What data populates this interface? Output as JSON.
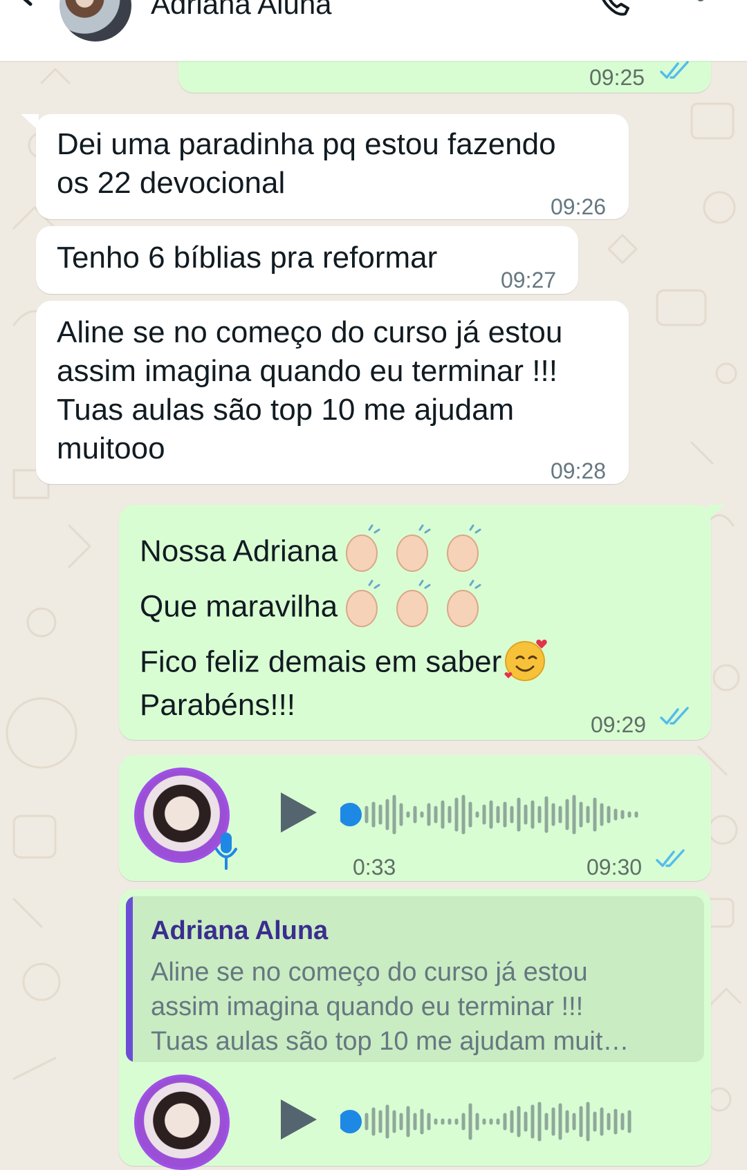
{
  "header": {
    "contact_name": "Adriana Aluna"
  },
  "messages": {
    "m0": {
      "time": "09:25",
      "read": true
    },
    "m1": {
      "line1": "Dei uma paradinha pq estou fazendo",
      "line2": "os  22 devocional",
      "time": "09:26"
    },
    "m2": {
      "text": "Tenho 6 bíblias pra reformar",
      "time": "09:27"
    },
    "m3": {
      "line1": "Aline se no começo do curso já estou",
      "line2": "assim imagina quando eu terminar !!!",
      "line3": "Tuas aulas são top 10 me ajudam",
      "line4": "muitooo",
      "time": "09:28"
    },
    "m4": {
      "line1": "Nossa Adriana",
      "line2": "Que maravilha",
      "line3": "Fico feliz demais em saber",
      "line4": "Parabéns!!!",
      "time": "09:29",
      "line1_emoji": "clapping-hands x3",
      "line2_emoji": "clapping-hands x3",
      "line3_emoji": "smiling-face-with-hearts"
    },
    "m5": {
      "duration": "0:33",
      "time": "09:30",
      "progress": 0
    },
    "m6": {
      "quote_author": "Adriana Aluna",
      "quote_line1": "Aline se no começo do curso já estou",
      "quote_line2": "assim imagina quando eu terminar !!!",
      "quote_line3": "Tuas aulas são top 10 me ajudam muit…",
      "progress": 0
    }
  },
  "colors": {
    "incoming_bubble": "#ffffff",
    "outgoing_bubble": "#d9fdd3",
    "read_ticks": "#53bdeb",
    "play_dot": "#1e88e5",
    "quote_bar": "#6a4fd6",
    "quote_author": "#3a2d8f"
  },
  "icons": {
    "back": "arrow-left-icon",
    "call": "phone-icon",
    "more": "more-vertical-icon",
    "play": "play-icon",
    "mic": "microphone-icon",
    "ticks": "double-check-icon"
  }
}
